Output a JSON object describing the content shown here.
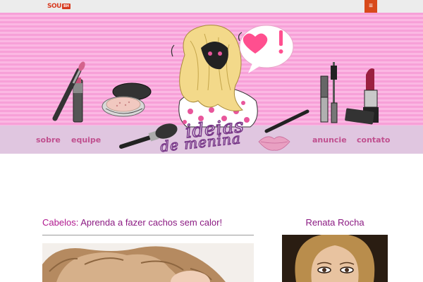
{
  "topbar": {
    "logo_main": "SOU",
    "logo_sub": "BH",
    "menu_icon": "hamburger-menu-icon",
    "menu_glyph": "≡",
    "menu_color": "#d84a1b"
  },
  "header": {
    "brand_line1": "ideias",
    "brand_line2": "de menina",
    "speech_bubble_mark": "!",
    "nav": {
      "sobre": "sobre",
      "equipe": "equipe",
      "anuncie": "anuncie",
      "contato": "contato"
    },
    "colors": {
      "banner_pink": "#f9a6da",
      "nav_strip": "#e0c6e0",
      "nav_text": "#c0508f"
    }
  },
  "post": {
    "category": "Cabelos:",
    "title": "Aprenda a fazer cachos sem calor!",
    "category_color": "#b0198f",
    "title_color": "#8b1a82"
  },
  "sidebar": {
    "author_name": "Renata Rocha"
  }
}
